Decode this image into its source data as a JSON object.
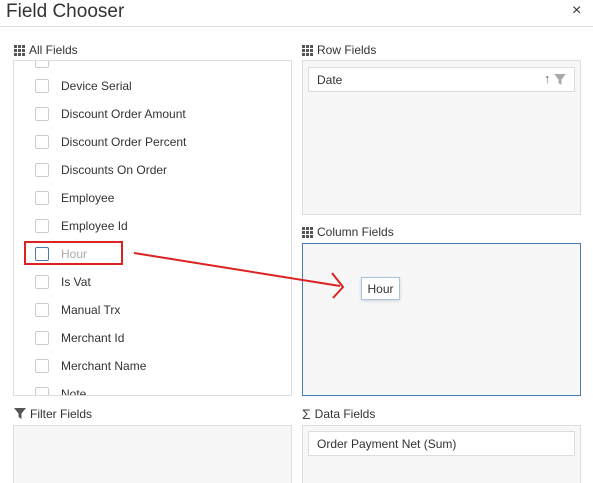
{
  "dialog": {
    "title": "Field Chooser",
    "close_label": "×"
  },
  "all_fields": {
    "label": "All Fields",
    "items": [
      {
        "label": "Device Serial",
        "checked": false
      },
      {
        "label": "Discount Order Amount",
        "checked": false
      },
      {
        "label": "Discount Order Percent",
        "checked": false
      },
      {
        "label": "Discounts On Order",
        "checked": false
      },
      {
        "label": "Employee",
        "checked": false
      },
      {
        "label": "Employee Id",
        "checked": false
      },
      {
        "label": "Hour",
        "checked": false,
        "dimmed": true
      },
      {
        "label": "Is Vat",
        "checked": false
      },
      {
        "label": "Manual Trx",
        "checked": false
      },
      {
        "label": "Merchant Id",
        "checked": false
      },
      {
        "label": "Merchant Name",
        "checked": false
      },
      {
        "label": "Note",
        "checked": false
      }
    ]
  },
  "row_fields": {
    "label": "Row Fields",
    "items": [
      {
        "label": "Date",
        "sort_icon": "sort-asc-icon",
        "filter_icon": "filter-icon"
      }
    ]
  },
  "column_fields": {
    "label": "Column Fields",
    "drag_chip": "Hour"
  },
  "filter_fields": {
    "label": "Filter Fields"
  },
  "data_fields": {
    "label": "Data Fields",
    "items": [
      {
        "label": "Order Payment Net (Sum)"
      }
    ]
  },
  "annotation": {
    "color": "#dd2222"
  }
}
